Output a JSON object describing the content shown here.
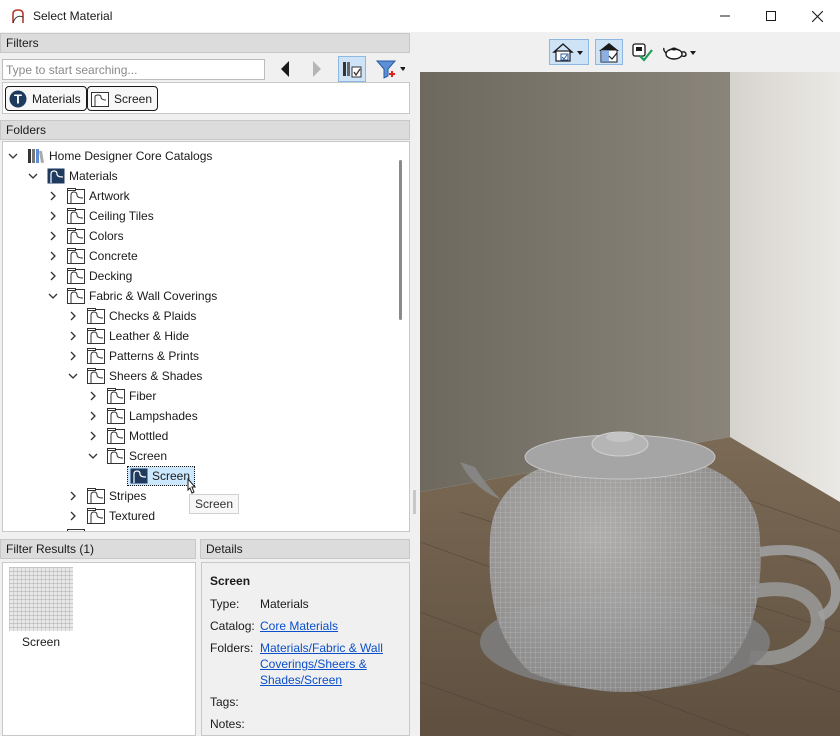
{
  "window": {
    "title": "Select Material"
  },
  "filters": {
    "header": "Filters",
    "search_placeholder": "Type to start searching...",
    "chips": [
      {
        "label": "Materials",
        "icon": "materials-t-icon"
      },
      {
        "label": "Screen",
        "icon": "material-folder-icon"
      }
    ]
  },
  "folders": {
    "header": "Folders",
    "items": [
      {
        "label": "Home Designer Core Catalogs",
        "depth": 0,
        "expanded": true,
        "icon": "catalog-library-icon"
      },
      {
        "label": "Materials",
        "depth": 1,
        "expanded": true,
        "icon": "materials-root-icon"
      },
      {
        "label": "Artwork",
        "depth": 2,
        "expanded": false,
        "icon": "material-folder-icon"
      },
      {
        "label": "Ceiling Tiles",
        "depth": 2,
        "expanded": false,
        "icon": "material-folder-icon"
      },
      {
        "label": "Colors",
        "depth": 2,
        "expanded": false,
        "icon": "material-folder-icon"
      },
      {
        "label": "Concrete",
        "depth": 2,
        "expanded": false,
        "icon": "material-folder-icon"
      },
      {
        "label": "Decking",
        "depth": 2,
        "expanded": false,
        "icon": "material-folder-icon"
      },
      {
        "label": "Fabric & Wall Coverings",
        "depth": 2,
        "expanded": true,
        "icon": "material-folder-icon"
      },
      {
        "label": "Checks & Plaids",
        "depth": 3,
        "expanded": false,
        "icon": "material-folder-icon"
      },
      {
        "label": "Leather & Hide",
        "depth": 3,
        "expanded": false,
        "icon": "material-folder-icon"
      },
      {
        "label": "Patterns & Prints",
        "depth": 3,
        "expanded": false,
        "icon": "material-folder-icon"
      },
      {
        "label": "Sheers & Shades",
        "depth": 3,
        "expanded": true,
        "icon": "material-folder-icon"
      },
      {
        "label": "Fiber",
        "depth": 4,
        "expanded": false,
        "icon": "material-folder-icon"
      },
      {
        "label": "Lampshades",
        "depth": 4,
        "expanded": false,
        "icon": "material-folder-icon"
      },
      {
        "label": "Mottled",
        "depth": 4,
        "expanded": false,
        "icon": "material-folder-icon"
      },
      {
        "label": "Screen",
        "depth": 4,
        "expanded": true,
        "icon": "material-folder-icon"
      },
      {
        "label": "Screen",
        "depth": 5,
        "leaf": true,
        "selected": true,
        "icon": "material-item-icon"
      },
      {
        "label": "Stripes",
        "depth": 3,
        "expanded": false,
        "icon": "material-folder-icon"
      },
      {
        "label": "Textured",
        "depth": 3,
        "expanded": false,
        "icon": "material-folder-icon"
      }
    ],
    "tooltip": "Screen"
  },
  "results": {
    "header": "Filter Results (1)",
    "items": [
      {
        "label": "Screen"
      }
    ]
  },
  "details": {
    "header": "Details",
    "name": "Screen",
    "type_label": "Type:",
    "type_value": "Materials",
    "catalog_label": "Catalog:",
    "catalog_value": "Core Materials",
    "folders_label": "Folders:",
    "folders_lines": [
      "Materials/Fabric & Wall",
      "Coverings/Sheers &",
      "Shades/Screen"
    ],
    "tags_label": "Tags:",
    "notes_label": "Notes:"
  },
  "colors": {
    "selection": "#cce8ff",
    "link": "#0b4fc9",
    "folder_dark": "#1f3a5f"
  }
}
